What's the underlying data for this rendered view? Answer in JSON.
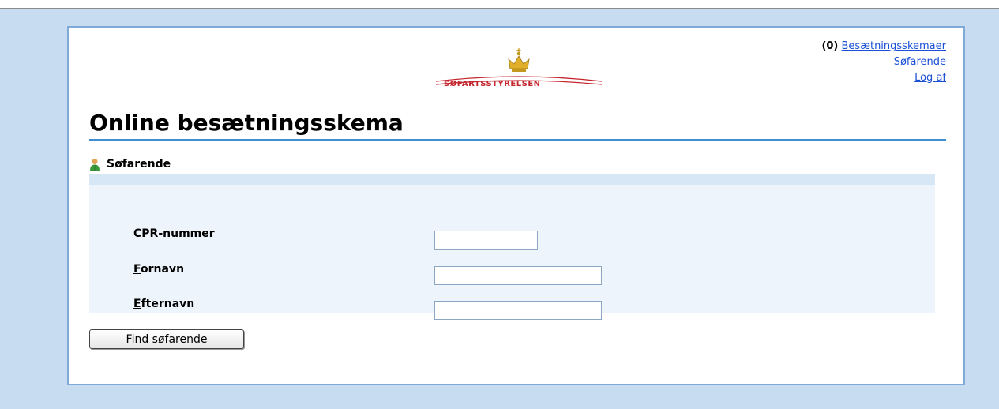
{
  "header": {
    "count": "(0)",
    "links": [
      "Besætningsskemaer",
      "Søfarende",
      "Log af"
    ]
  },
  "logo": {
    "text": "SØFARTSSTYRELSEN",
    "icon": "crown-icon",
    "color": "#c4262e"
  },
  "page": {
    "title": "Online besætningsskema"
  },
  "section": {
    "title": "Søfarende",
    "icon": "person-icon"
  },
  "form": {
    "fields": [
      {
        "label_first": "C",
        "label_rest": "PR-nummer",
        "value": ""
      },
      {
        "label_first": "F",
        "label_rest": "ornavn",
        "value": ""
      },
      {
        "label_first": "E",
        "label_rest": "fternavn",
        "value": ""
      }
    ]
  },
  "actions": {
    "find_label": "Find søfarende"
  },
  "colors": {
    "background": "#c7dbf1",
    "accent": "#3f8fd0",
    "link": "#1a4fd6"
  }
}
